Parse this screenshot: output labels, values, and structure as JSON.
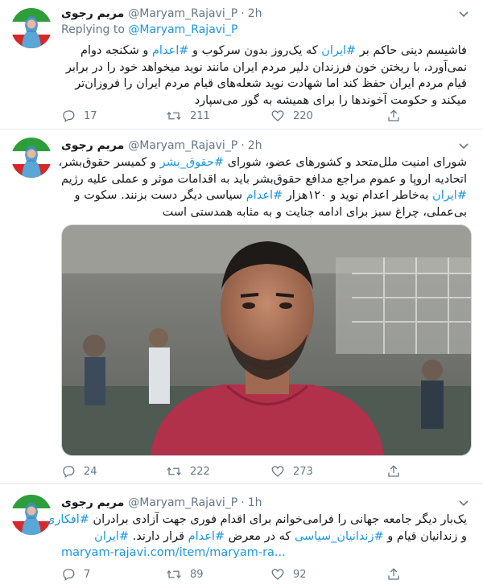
{
  "colors": {
    "link": "#1b95e0",
    "muted": "#657786",
    "text": "#14171a",
    "divider": "#e6ecf0"
  },
  "tweets": [
    {
      "name": "مریم رجوی",
      "handle": "@Maryam_Rajavi_P",
      "dot": "·",
      "time": "2h",
      "replying_to_label": "Replying to",
      "replying_to_user": "@Maryam_Rajavi_P",
      "lines": [
        [
          "فاشیسم دینی حاکم بر ",
          "#ایران",
          " که یک‌روز بدون سرکوب و ",
          "#اعدام",
          " و شکنجه دوام"
        ],
        [
          "نمی‌آورد، با ریختن خون فرزندان دلیر مردم ایران مانند نوید میخواهد خود را در برابر"
        ],
        [
          "قیام مردم ایران حفظ کند اما شهادت نوید شعله‌های قیام مردم ایران را فروزان‌تر"
        ],
        [
          "میکند و حکومت آخوندها را برای همیشه به گور می‌سپارد"
        ]
      ],
      "replies": "17",
      "retweets": "211",
      "likes": "220"
    },
    {
      "name": "مریم رجوی",
      "handle": "@Maryam_Rajavi_P",
      "dot": "·",
      "time": "2h",
      "lines": [
        [
          "شورای امنیت ملل‌متحد و کشورهای عضو، شورای ",
          "#حقوق_بشر",
          " و کمیسر حقوق‌بشر،"
        ],
        [
          "اتحادیه اروپا و عموم مراجع مدافع حقوق‌بشر باید به اقدامات موثر و عملی علیه رژیم"
        ],
        [
          "#ایران",
          " به‌خاطر اعدام نوید و ۱۲۰هزار ",
          "#اعدام",
          " سیاسی دیگر دست بزنند. سکوت و"
        ],
        [
          "بی‌عملی، چراغ سبز برای ادامه جنایت و به مثابه همدستی است"
        ]
      ],
      "image_alt": "photo-of-wrestler",
      "replies": "24",
      "retweets": "222",
      "likes": "273"
    },
    {
      "name": "مریم رجوی",
      "handle": "@Maryam_Rajavi_P",
      "dot": "·",
      "time": "1h",
      "lines": [
        [
          "یک‌بار دیگر جامعه جهانی را فرامی‌خوانم برای اقدام فوری جهت آزادی برادران ",
          "#افکاری"
        ],
        [
          "و زندانیان قیام و ",
          "#زندانیان_سیاسی",
          " که در معرض ",
          "#اعدام",
          " قرار دارند. ",
          "#ایران"
        ]
      ],
      "link": "maryam-rajavi.com/item/maryam-ra...",
      "replies": "7",
      "retweets": "89",
      "likes": "92"
    }
  ]
}
